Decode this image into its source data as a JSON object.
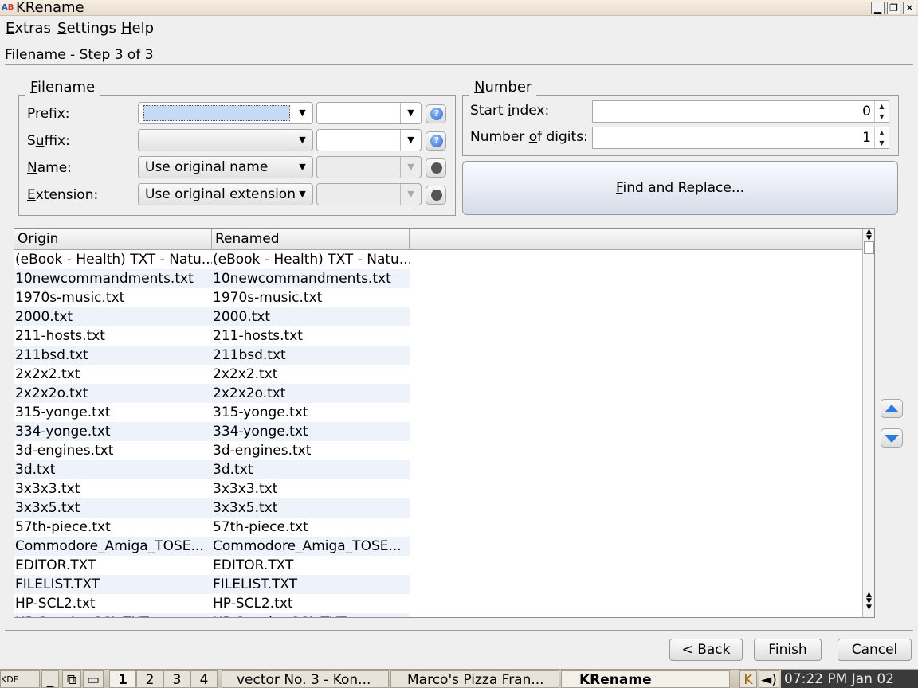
{
  "window": {
    "title": "KRename",
    "icon": "krename-icon"
  },
  "menu": [
    {
      "label_pre": "",
      "label_u": "E",
      "label_post": "xtras"
    },
    {
      "label_pre": "",
      "label_u": "S",
      "label_post": "ettings"
    },
    {
      "label_pre": "",
      "label_u": "H",
      "label_post": "elp"
    }
  ],
  "step_title": "Filename - Step 3 of 3",
  "filename_group": {
    "title_u": "F",
    "title_rest": "ilename",
    "prefix": {
      "label_u": "P",
      "label_rest": "refix:",
      "value": "",
      "value2": ""
    },
    "suffix": {
      "label_pre": "S",
      "label_u": "u",
      "label_rest": "ffix:",
      "value": "",
      "value2": ""
    },
    "name": {
      "label_u": "N",
      "label_rest": "ame:",
      "value": "Use original name"
    },
    "extension": {
      "label_u": "E",
      "label_rest": "xtension:",
      "value": "Use original extension"
    }
  },
  "number_group": {
    "title_u": "N",
    "title_rest": "umber",
    "start_index": {
      "label_pre": "Start ",
      "label_u": "i",
      "label_rest": "ndex:",
      "value": "0"
    },
    "digits": {
      "label_pre": "Number ",
      "label_u": "o",
      "label_rest": "f digits:",
      "value": "1"
    }
  },
  "find_replace": {
    "label_u": "F",
    "label_rest": "ind and Replace..."
  },
  "list": {
    "columns": [
      "Origin",
      "Renamed"
    ],
    "rows": [
      [
        "(eBook - Health) TXT - Natu...",
        "(eBook - Health) TXT - Natu..."
      ],
      [
        "10newcommandments.txt",
        "10newcommandments.txt"
      ],
      [
        "1970s-music.txt",
        "1970s-music.txt"
      ],
      [
        "2000.txt",
        "2000.txt"
      ],
      [
        "211-hosts.txt",
        "211-hosts.txt"
      ],
      [
        "211bsd.txt",
        "211bsd.txt"
      ],
      [
        "2x2x2.txt",
        "2x2x2.txt"
      ],
      [
        "2x2x2o.txt",
        "2x2x2o.txt"
      ],
      [
        "315-yonge.txt",
        "315-yonge.txt"
      ],
      [
        "334-yonge.txt",
        "334-yonge.txt"
      ],
      [
        "3d-engines.txt",
        "3d-engines.txt"
      ],
      [
        "3d.txt",
        "3d.txt"
      ],
      [
        "3x3x3.txt",
        "3x3x3.txt"
      ],
      [
        "3x3x5.txt",
        "3x3x5.txt"
      ],
      [
        "57th-piece.txt",
        "57th-piece.txt"
      ],
      [
        "Commodore_Amiga_TOSE...",
        "Commodore_Amiga_TOSE..."
      ],
      [
        "EDITOR.TXT",
        "EDITOR.TXT"
      ],
      [
        "FILELIST.TXT",
        "FILELIST.TXT"
      ],
      [
        "HP-SCL2.txt",
        "HP-SCL2.txt"
      ],
      [
        "HP-Scanjet-SCL.TXT",
        "HP-Scanjet-SCL.TXT"
      ]
    ]
  },
  "buttons": {
    "back": {
      "pre": "< ",
      "u": "B",
      "rest": "ack"
    },
    "finish": {
      "u": "F",
      "rest": "inish"
    },
    "cancel": {
      "u": "C",
      "rest": "ancel"
    }
  },
  "taskbar": {
    "desktops": [
      "1",
      "2",
      "3",
      "4"
    ],
    "tasks": [
      "vector No. 3 - Kon...",
      "Marco's Pizza Fran...",
      "KRename"
    ],
    "clock": "07:22 PM Jan 02"
  }
}
